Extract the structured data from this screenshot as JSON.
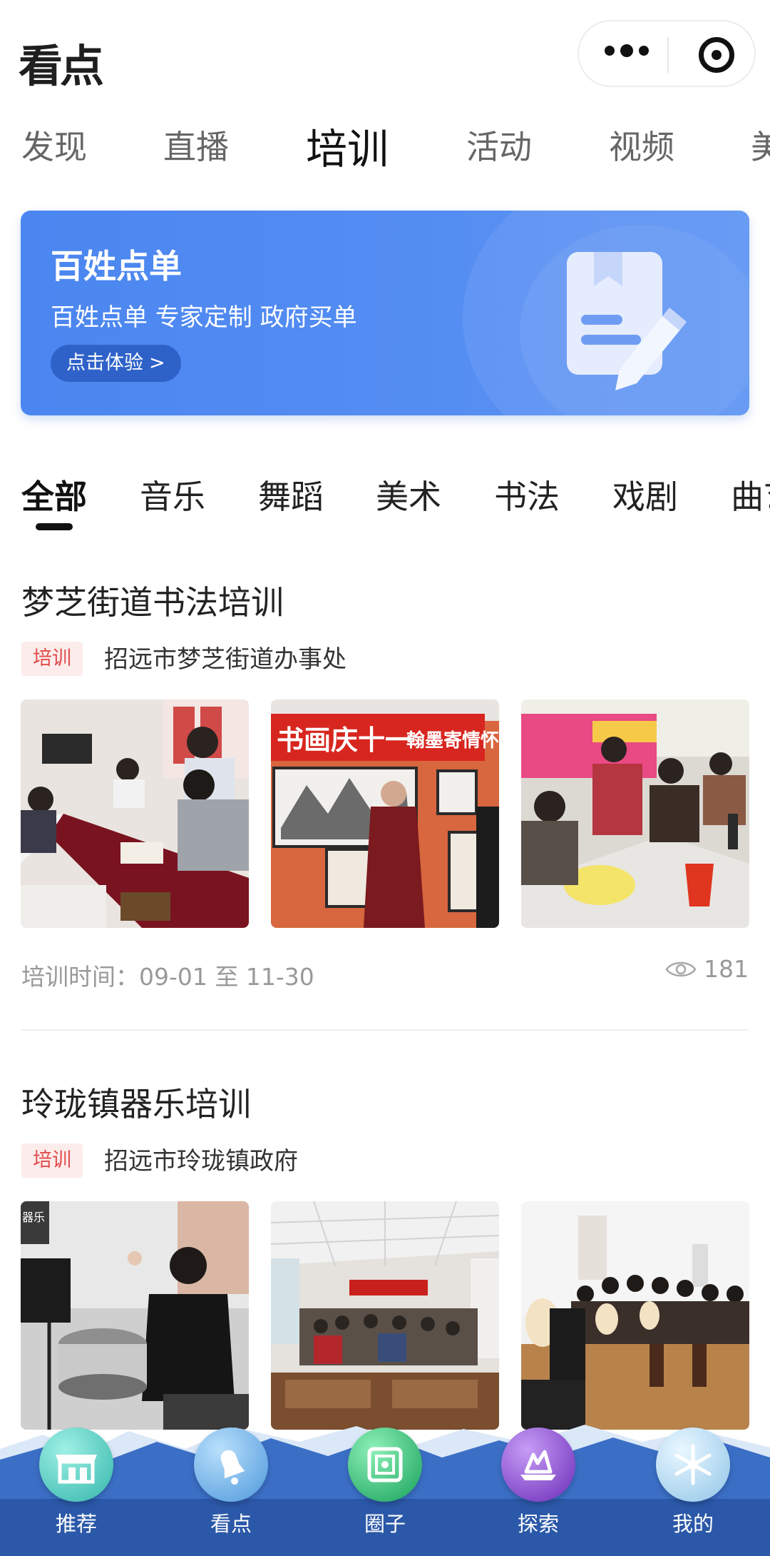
{
  "app": {
    "logo_text": "看点"
  },
  "top_tabs": [
    "发现",
    "直播",
    "培训",
    "活动",
    "视频",
    "美"
  ],
  "top_tabs_active": "培训",
  "banner": {
    "title": "百姓点单",
    "subtitle": "百姓点单 专家定制 政府买单",
    "button_label": "点击体验",
    "chevron": ">"
  },
  "category_tabs": [
    "全部",
    "音乐",
    "舞蹈",
    "美术",
    "书法",
    "戏剧",
    "曲艺"
  ],
  "category_active": "全部",
  "cards": [
    {
      "title": "梦芝街道书法培训",
      "tag": "培训",
      "org": "招远市梦芝街道办事处",
      "time": "培训时间：09-01 至 11-30",
      "views": "181",
      "photo_captions": [
        "书画庆十一",
        "翰墨寄情怀"
      ]
    },
    {
      "title": "玲珑镇器乐培训",
      "tag": "培训",
      "org": "招远市玲珑镇政府",
      "photo_captions": [
        "器乐"
      ]
    }
  ],
  "bottom_nav": [
    {
      "label": "推荐",
      "icon": "shop-icon",
      "color": "#43c3b8"
    },
    {
      "label": "看点",
      "icon": "bell-icon",
      "color": "#5aa9e6"
    },
    {
      "label": "圈子",
      "icon": "frame-icon",
      "color": "#2bb673"
    },
    {
      "label": "探索",
      "icon": "explore-icon",
      "color": "#7b3fc9"
    },
    {
      "label": "我的",
      "icon": "snowflake-icon",
      "color": "#a8d8f0"
    }
  ],
  "colors": {
    "banner_blue": "#4b86f0",
    "tag_red": "#e24a4a",
    "nav_blue": "#2f5fb8"
  }
}
